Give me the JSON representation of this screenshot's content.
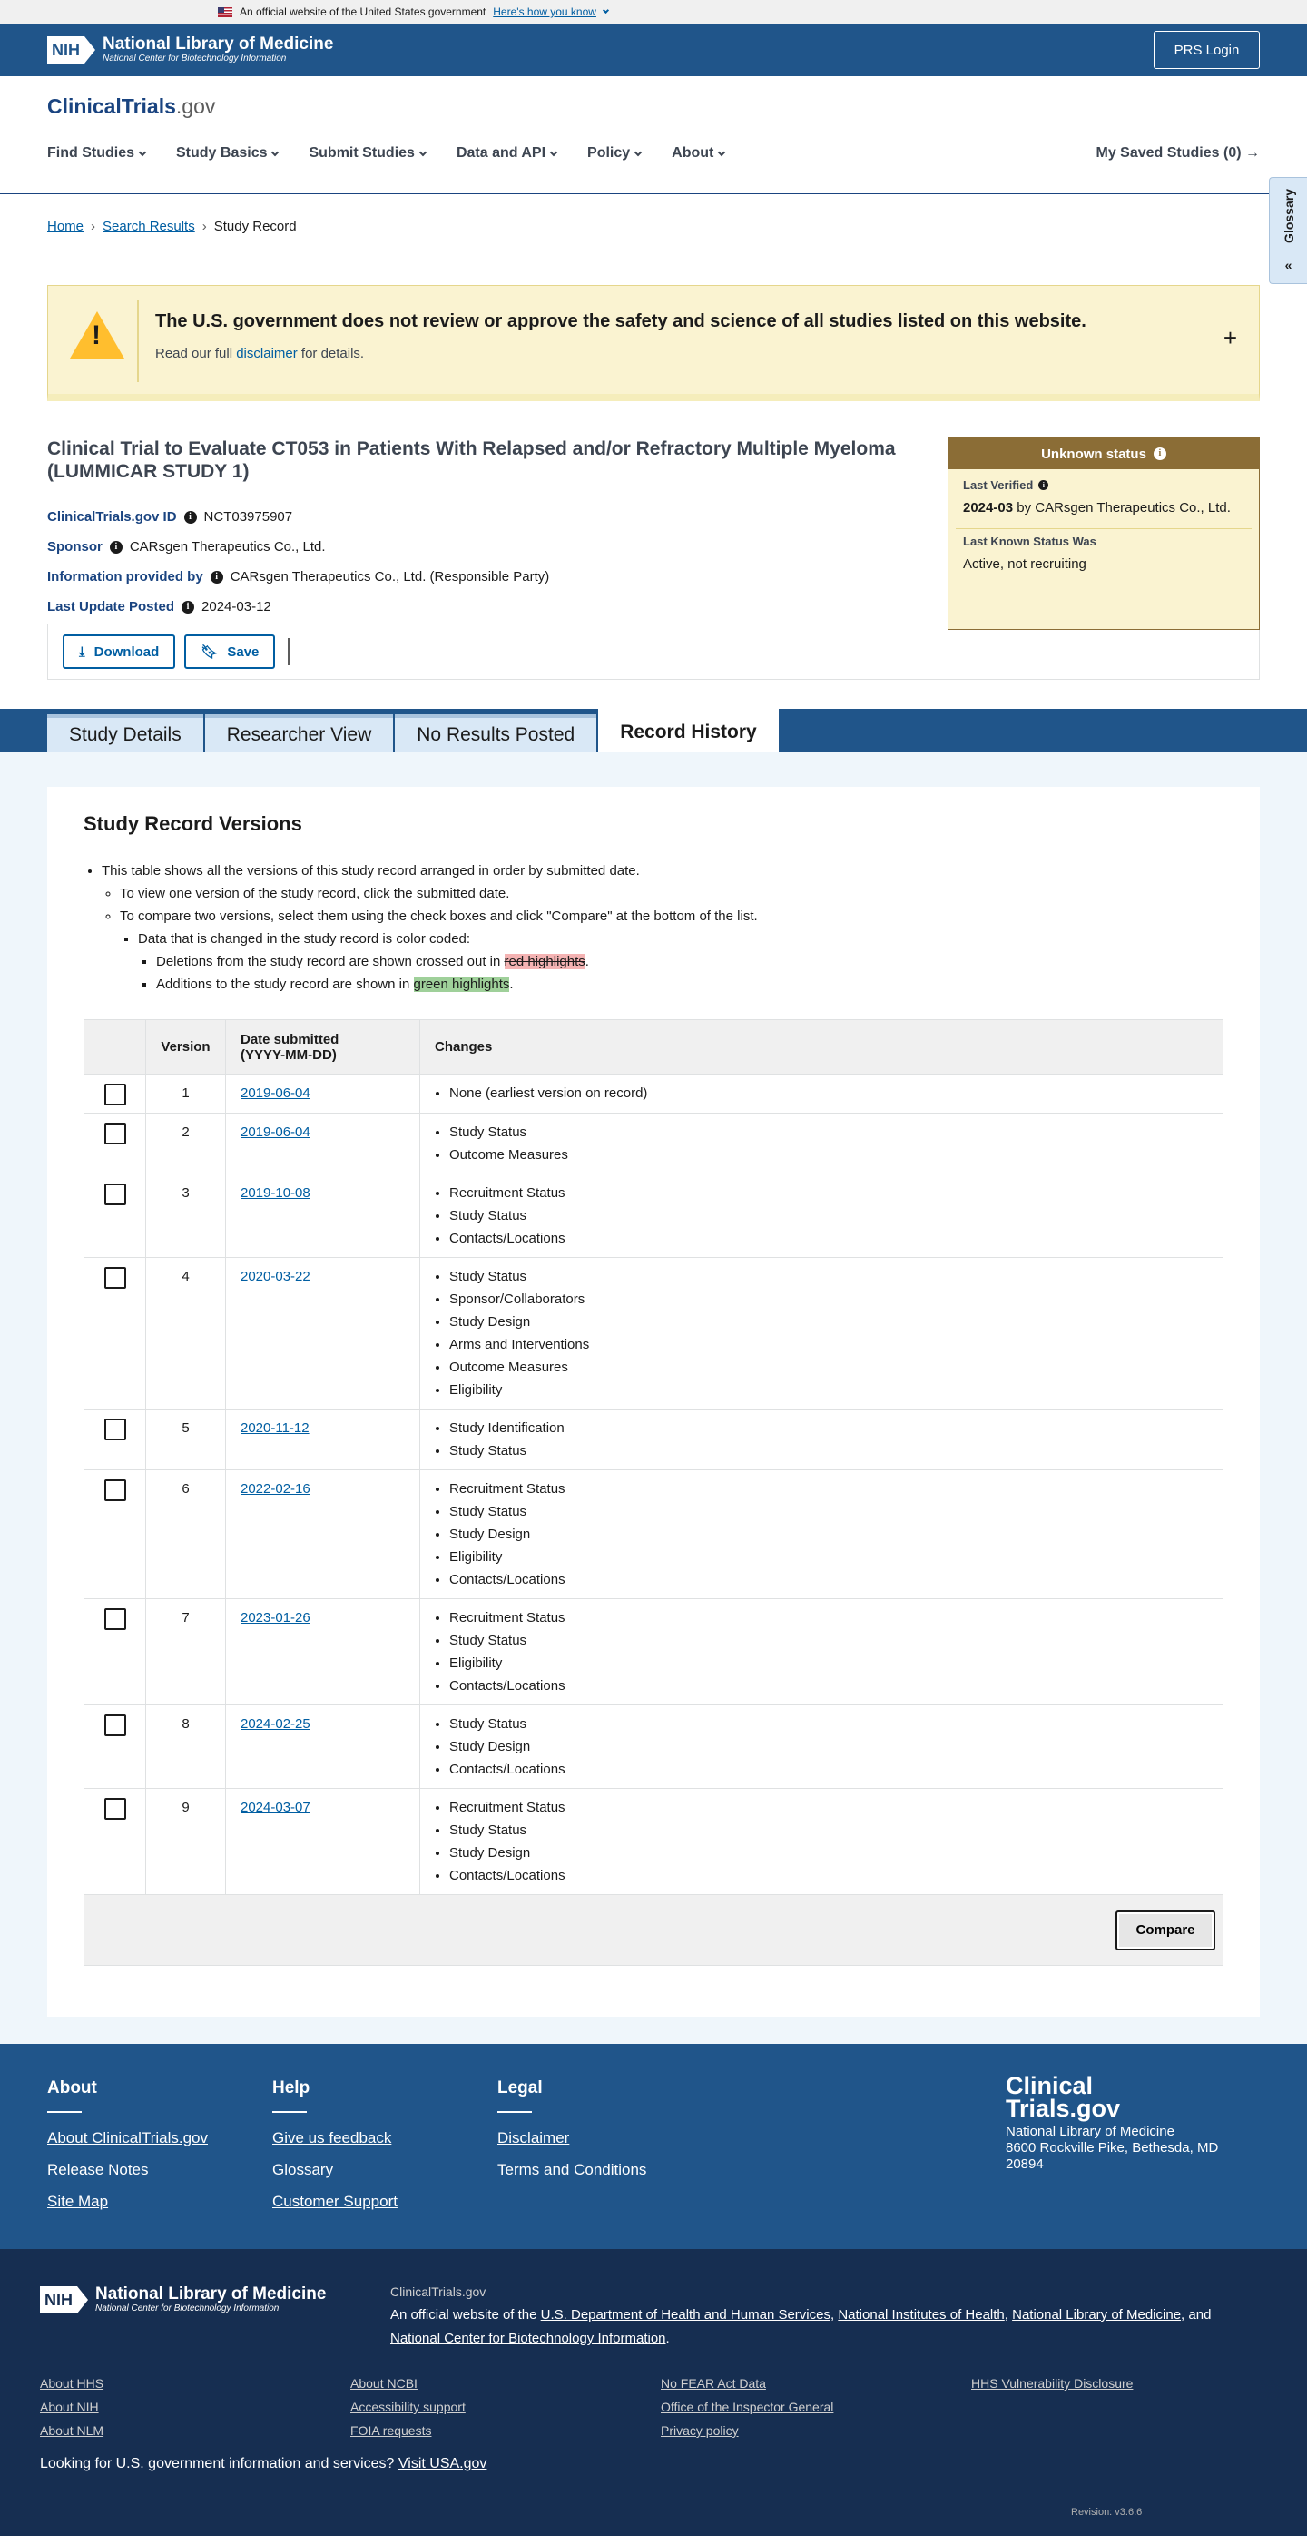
{
  "gov_banner": {
    "text": "An official website of the United States government",
    "link": "Here's how you know"
  },
  "nih_bar": {
    "badge": "NIH",
    "name": "National Library of Medicine",
    "subname": "National Center for Biotechnology Information",
    "login": "PRS Login"
  },
  "header": {
    "brand_main": "ClinicalTrials",
    "brand_suffix": ".gov",
    "nav": [
      "Find Studies",
      "Study Basics",
      "Submit Studies",
      "Data and API",
      "Policy",
      "About"
    ],
    "saved": "My Saved Studies (0)",
    "glossary": "Glossary"
  },
  "breadcrumb": [
    "Home",
    "Search Results",
    "Study Record"
  ],
  "disclaimer": {
    "heading": "The U.S. government does not review or approve the safety and science of all studies listed on this website.",
    "pre": "Read our full ",
    "link": "disclaimer",
    "post": " for details."
  },
  "study": {
    "title": "Clinical Trial to Evaluate CT053 in Patients With Relapsed and/or Refractory Multiple Myeloma (LUMMICAR STUDY 1)",
    "meta": [
      {
        "label": "ClinicalTrials.gov ID",
        "value": "NCT03975907"
      },
      {
        "label": "Sponsor",
        "value": "CARsgen Therapeutics Co., Ltd."
      },
      {
        "label": "Information provided by",
        "value": "CARsgen Therapeutics Co., Ltd. (Responsible Party)"
      },
      {
        "label": "Last Update Posted",
        "value": "2024-03-12"
      }
    ],
    "status": {
      "header": "Unknown status",
      "last_verified_label": "Last Verified",
      "last_verified_date": "2024-03",
      "last_verified_by": " by CARsgen Therapeutics Co., Ltd.",
      "last_known_label": "Last Known Status Was",
      "last_known_value": "Active, not recruiting"
    }
  },
  "actions": {
    "download": "Download",
    "save": "Save"
  },
  "tabs": [
    "Study Details",
    "Researcher View",
    "No Results Posted",
    "Record History"
  ],
  "versions": {
    "heading": "Study Record Versions",
    "note1": "This table shows all the versions of this study record arranged in order by submitted date.",
    "note2": "To view one version of the study record, click the submitted date.",
    "note3": "To compare two versions, select them using the check boxes and click \"Compare\" at the bottom of the list.",
    "note4": "Data that is changed in the study record is color coded:",
    "note5_pre": "Deletions from the study record are shown crossed out in ",
    "note5_hl": "red highlights",
    "note6_pre": "Additions to the study record are shown in ",
    "note6_hl": "green highlights",
    "period": ".",
    "col_version": "Version",
    "col_date_1": "Date submitted",
    "col_date_2": "(YYYY-MM-DD)",
    "col_changes": "Changes",
    "compare": "Compare",
    "rows": [
      {
        "version": "1",
        "date": "2019-06-04",
        "changes": [
          "None (earliest version on record)"
        ]
      },
      {
        "version": "2",
        "date": "2019-06-04",
        "changes": [
          "Study Status",
          "Outcome Measures"
        ]
      },
      {
        "version": "3",
        "date": "2019-10-08",
        "changes": [
          "Recruitment Status",
          "Study Status",
          "Contacts/Locations"
        ]
      },
      {
        "version": "4",
        "date": "2020-03-22",
        "changes": [
          "Study Status",
          "Sponsor/Collaborators",
          "Study Design",
          "Arms and Interventions",
          "Outcome Measures",
          "Eligibility"
        ]
      },
      {
        "version": "5",
        "date": "2020-11-12",
        "changes": [
          "Study Identification",
          "Study Status"
        ]
      },
      {
        "version": "6",
        "date": "2022-02-16",
        "changes": [
          "Recruitment Status",
          "Study Status",
          "Study Design",
          "Eligibility",
          "Contacts/Locations"
        ]
      },
      {
        "version": "7",
        "date": "2023-01-26",
        "changes": [
          "Recruitment Status",
          "Study Status",
          "Eligibility",
          "Contacts/Locations"
        ]
      },
      {
        "version": "8",
        "date": "2024-02-25",
        "changes": [
          "Study Status",
          "Study Design",
          "Contacts/Locations"
        ]
      },
      {
        "version": "9",
        "date": "2024-03-07",
        "changes": [
          "Recruitment Status",
          "Study Status",
          "Study Design",
          "Contacts/Locations"
        ]
      }
    ]
  },
  "footer": {
    "about_title": "About",
    "about_links": [
      "About ClinicalTrials.gov",
      "Release Notes",
      "Site Map"
    ],
    "help_title": "Help",
    "help_links": [
      "Give us feedback",
      "Glossary",
      "Customer Support"
    ],
    "legal_title": "Legal",
    "legal_links": [
      "Disclaimer",
      "Terms and Conditions"
    ],
    "brand_1": "Clinical",
    "brand_2": "Trials.gov",
    "addr_1": "National Library of Medicine",
    "addr_2": "8600 Rockville Pike, Bethesda, MD",
    "addr_3": "20894"
  },
  "footer2": {
    "site": "ClinicalTrials.gov",
    "official_pre": "An official website of the ",
    "hhs": "U.S. Department of Health and Human Services",
    "nih": "National Institutes of Health",
    "nlm": "National Library of Medicine",
    "and": ", and ",
    "ncbi": "National Center for Biotechnology Information",
    "links": [
      "About HHS",
      "About NCBI",
      "No FEAR Act Data",
      "HHS Vulnerability Disclosure",
      "About NIH",
      "Accessibility support",
      "Office of the Inspector General",
      "About NLM",
      "FOIA requests",
      "Privacy policy"
    ],
    "usa_pre": "Looking for U.S. government information and services? ",
    "usa_link": "Visit USA.gov",
    "revision": "Revision: v3.6.6"
  }
}
